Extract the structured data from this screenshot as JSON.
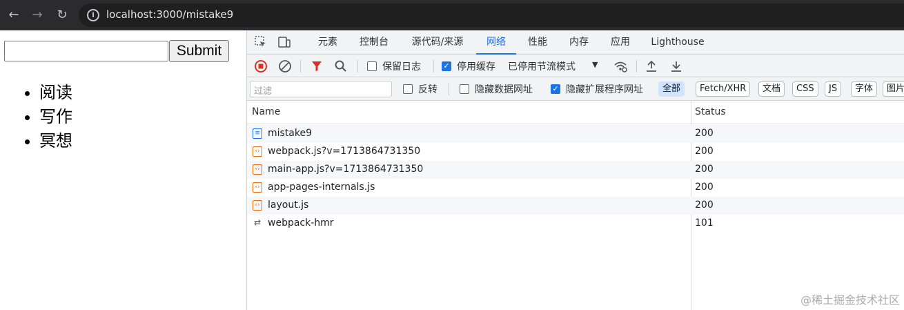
{
  "browser": {
    "url": "localhost:3000/mistake9",
    "back_icon": "←",
    "forward_icon": "→",
    "reload_icon": "↻",
    "info_icon": "i"
  },
  "page": {
    "input_value": "",
    "submit_label": "Submit",
    "list_items": [
      "阅读",
      "写作",
      "冥想"
    ]
  },
  "devtools": {
    "tabs": [
      "元素",
      "控制台",
      "源代码/来源",
      "网络",
      "性能",
      "内存",
      "应用",
      "Lighthouse"
    ],
    "active_tab": "网络",
    "toolbar1": {
      "preserve_log_label": "保留日志",
      "disable_cache_label": "停用缓存",
      "throttle_label": "已停用节流模式"
    },
    "toolbar2": {
      "filter_placeholder": "过滤",
      "invert_label": "反转",
      "hide_data_urls_label": "隐藏数据网址",
      "hide_extension_urls_label": "隐藏扩展程序网址",
      "chips": [
        "全部",
        "Fetch/XHR",
        "文档",
        "CSS",
        "JS",
        "字体",
        "图片"
      ]
    },
    "grid": {
      "columns": [
        "Name",
        "Status"
      ],
      "rows": [
        {
          "name": "mistake9",
          "status": "200",
          "type": "doc"
        },
        {
          "name": "webpack.js?v=1713864731350",
          "status": "200",
          "type": "script"
        },
        {
          "name": "main-app.js?v=1713864731350",
          "status": "200",
          "type": "script"
        },
        {
          "name": "app-pages-internals.js",
          "status": "200",
          "type": "script"
        },
        {
          "name": "layout.js",
          "status": "200",
          "type": "script"
        },
        {
          "name": "webpack-hmr",
          "status": "101",
          "type": "ws"
        }
      ]
    }
  },
  "watermark": "@稀土掘金技术社区",
  "colors": {
    "accent": "#1a73e8",
    "record": "#d93025",
    "filter": "#d93025"
  }
}
